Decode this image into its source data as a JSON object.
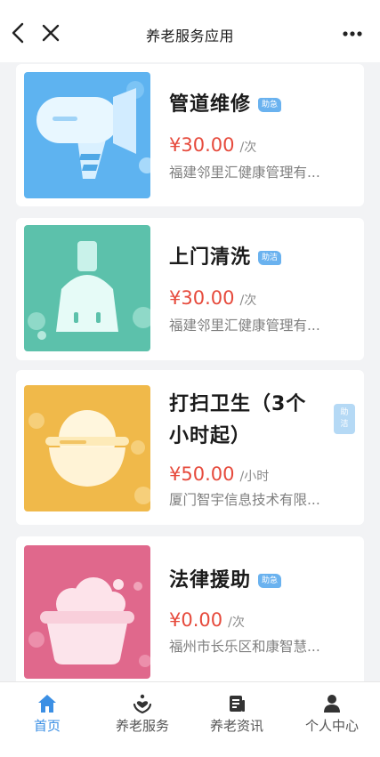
{
  "nav": {
    "title": "养老服务应用",
    "back_icon": "chevron-left-icon",
    "close_icon": "close-icon",
    "more_icon": "more-icon"
  },
  "services": [
    {
      "title": "管道维修",
      "badge": "助急",
      "price": "¥30.00",
      "unit": "/次",
      "vendor": "福建邻里汇健康管理有...",
      "image": "hair-dryer-illustration",
      "thumb_bg": "#5eb3f0"
    },
    {
      "title": "上门清洗",
      "badge": "助洁",
      "price": "¥30.00",
      "unit": "/次",
      "vendor": "福建邻里汇健康管理有...",
      "image": "broom-illustration",
      "thumb_bg": "#5cc1ab"
    },
    {
      "title_line1": "打扫卫生（3个",
      "title_line2": "小时起）",
      "badge_line1": "助",
      "badge_line2": "洁",
      "price": "¥50.00",
      "unit": "/小时",
      "vendor": "厦门智宇信息技术有限...",
      "image": "rice-bowl-illustration",
      "thumb_bg": "#f0b94a"
    },
    {
      "title": "法律援助",
      "badge": "助急",
      "price": "¥0.00",
      "unit": "/次",
      "vendor": "福州市长乐区和康智慧...",
      "image": "bathtub-illustration",
      "thumb_bg": "#e0688c"
    }
  ],
  "tabs": [
    {
      "label": "首页",
      "icon": "home-icon",
      "active": true
    },
    {
      "label": "养老服务",
      "icon": "heart-hands-icon",
      "active": false
    },
    {
      "label": "养老资讯",
      "icon": "news-icon",
      "active": false
    },
    {
      "label": "个人中心",
      "icon": "person-icon",
      "active": false
    }
  ],
  "colors": {
    "accent": "#3b8fe4",
    "price": "#e64a3c",
    "badge": "#6ab2ef"
  }
}
